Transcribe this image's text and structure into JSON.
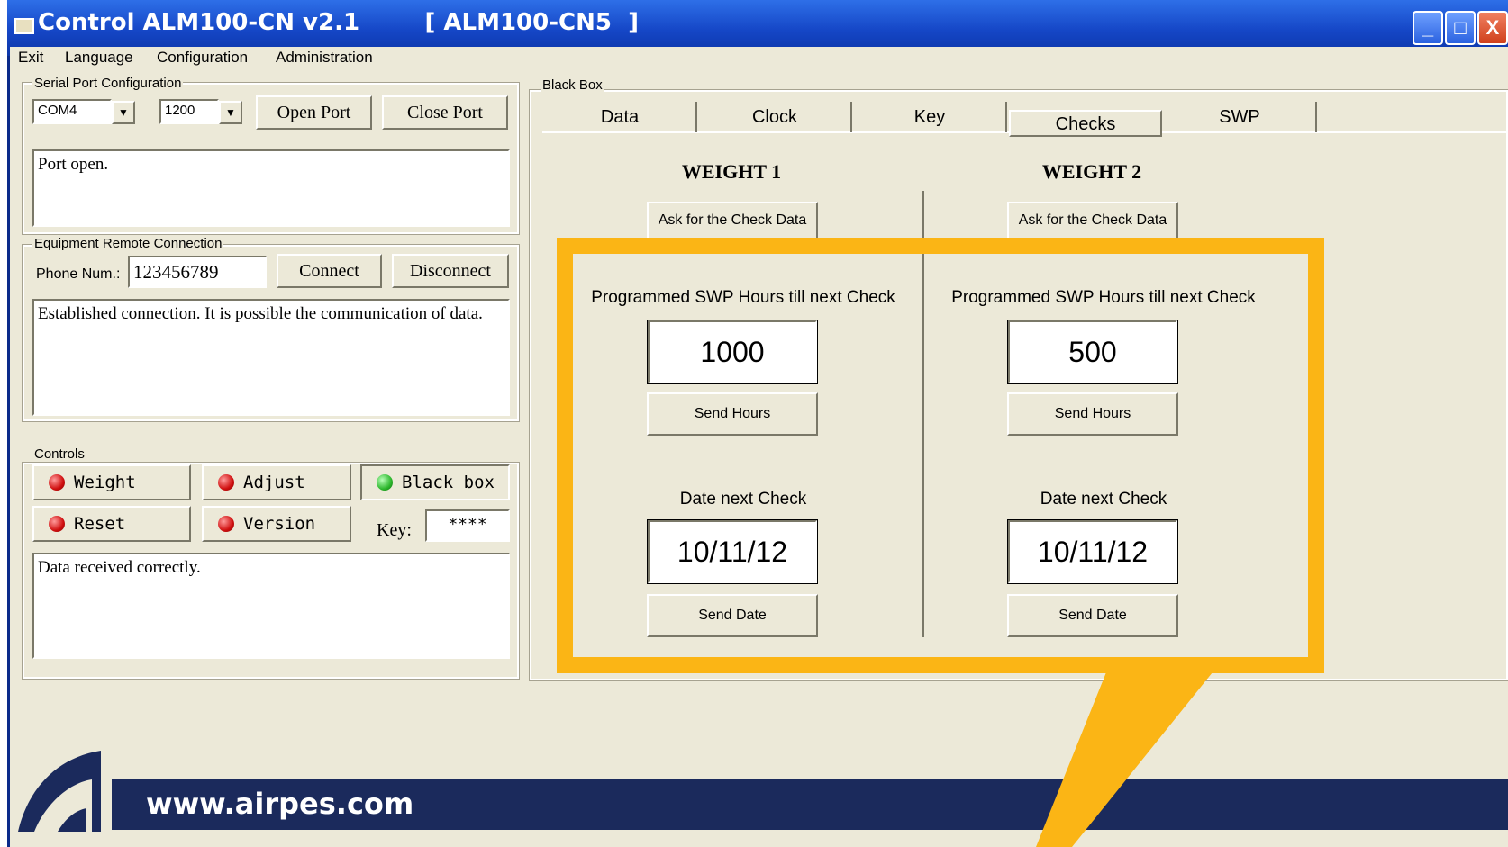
{
  "window": {
    "title": "Control ALM100-CN v2.1        [ ALM100-CN5  ]",
    "controls": {
      "minimize": "_",
      "maximize": "□",
      "close": "X"
    }
  },
  "menu": [
    "Exit",
    "Language",
    "Configuration",
    "Administration"
  ],
  "serial": {
    "group_label": "Serial Port Configuration",
    "port": "COM4",
    "baud": "1200",
    "open_label": "Open Port",
    "close_label": "Close Port",
    "log": "Port open."
  },
  "remote": {
    "group_label": "Equipment Remote Connection",
    "phone_label": "Phone Num.:",
    "phone_value": "123456789",
    "connect_label": "Connect",
    "disconnect_label": "Disconnect",
    "log": "Established connection. It is possible the communication of data."
  },
  "controls": {
    "group_label": "Controls",
    "weight": "Weight",
    "adjust": "Adjust",
    "blackbox": "Black box",
    "reset": "Reset",
    "version": "Version",
    "key_label": "Key:",
    "key_value": "****",
    "log": "Data received correctly."
  },
  "blackbox": {
    "group_label": "Black Box",
    "tabs": [
      "Data",
      "Clock",
      "Key",
      "Checks",
      "SWP"
    ],
    "active_tab": "Checks",
    "weight1": {
      "heading": "WEIGHT 1",
      "ask_label": "Ask for the Check Data",
      "hours_label": "Programmed SWP Hours till next Check",
      "hours_value": "1000",
      "send_hours": "Send Hours",
      "date_label": "Date next Check",
      "date_value": "10/11/12",
      "send_date": "Send Date"
    },
    "weight2": {
      "heading": "WEIGHT 2",
      "ask_label": "Ask for the Check Data",
      "hours_label": "Programmed SWP Hours till next Check",
      "hours_value": "500",
      "send_hours": "Send Hours",
      "date_label": "Date next Check",
      "date_value": "10/11/12",
      "send_date": "Send Date"
    }
  },
  "footer": {
    "url": "www.airpes.com"
  },
  "colors": {
    "highlight": "#fbb515",
    "footer": "#1b2a5c",
    "titlebar": "#1546c6"
  }
}
